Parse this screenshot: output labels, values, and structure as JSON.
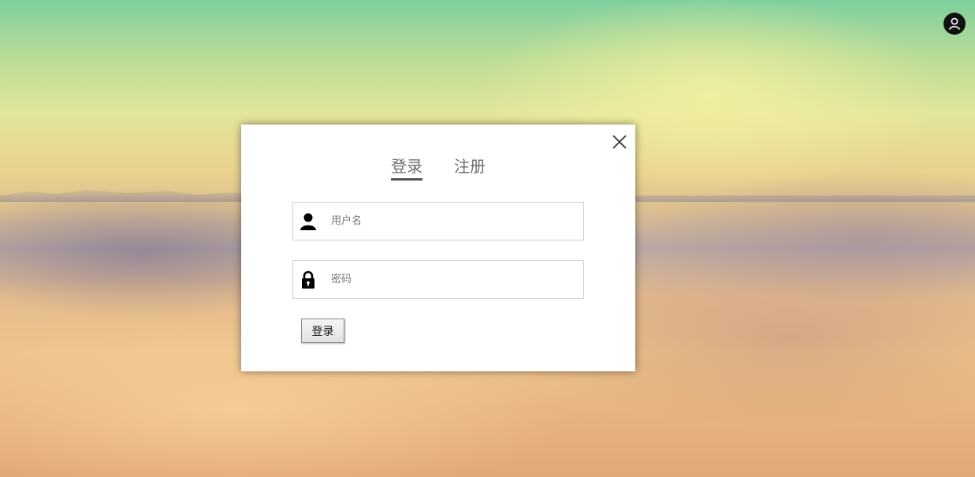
{
  "tabs": {
    "login": "登录",
    "register": "注册",
    "active": "login"
  },
  "form": {
    "username_placeholder": "用户名",
    "password_placeholder": "密码",
    "submit_label": "登录"
  },
  "icons": {
    "top_right": "user-circle-icon",
    "close": "close-icon",
    "username": "person-icon",
    "password": "lock-icon"
  },
  "colors": {
    "modal_bg": "#ffffff",
    "tab_text": "#6e6e6e",
    "badge_bg": "#111111"
  }
}
